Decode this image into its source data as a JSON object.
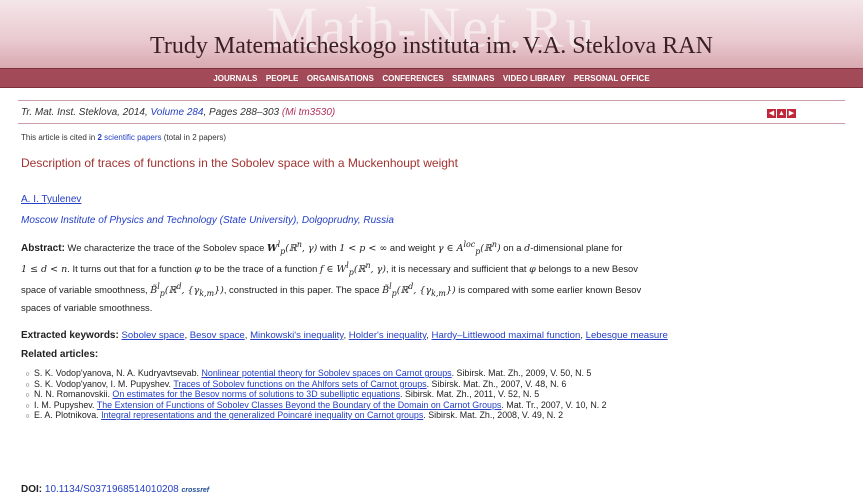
{
  "header": {
    "watermark": "Math-Net.Ru",
    "journal_title": "Trudy Matematicheskogo instituta im. V.A. Steklova RAN"
  },
  "nav": [
    "JOURNALS",
    "PEOPLE",
    "ORGANISATIONS",
    "CONFERENCES",
    "SEMINARS",
    "VIDEO LIBRARY",
    "PERSONAL OFFICE"
  ],
  "reference": {
    "prefix": "Tr. Mat. Inst. Steklova, 2014,",
    "volume_link": "Volume 284",
    "pages": ", Pages 288–303",
    "mi_id": "(Mi tm3530)"
  },
  "nav_arrows": [
    "◀",
    "▲",
    "▶"
  ],
  "cited": {
    "text_before": "This article is cited in",
    "count": "2",
    "link": "scientific papers",
    "text_after": "(total in 2 papers)"
  },
  "article": {
    "title": "Description of traces of functions in the Sobolev space with a Muckenhoupt weight",
    "author": "A. I. Tyulenev",
    "organization": "Moscow Institute of Physics and Technology (State University), Dolgoprudny, Russia"
  },
  "abstract": {
    "label": "Abstract:",
    "t1": " We characterize the trace of the Sobolev space ",
    "m1": "W",
    "m1_sup": "l",
    "m1_sub": "p",
    "m1_tail": "(ℝ",
    "m1_n": "n",
    "m1_end": ", γ)",
    "t2": " with ",
    "m2": "1 < p < ∞",
    "t3": " and weight ",
    "m3": "γ ∈ A",
    "m3_sup": "loc",
    "m3_sub": "p",
    "m3_tail": "(ℝ",
    "m3_n": "n",
    "m3_end": ")",
    "t4": " on a ",
    "m4": "d",
    "t5": "-dimensional plane for",
    "m5": "1 ≤ d < n",
    "t6": ". It turns out that for a function ",
    "m6": "φ",
    "t7": " to be the trace of a function ",
    "m7": "f ∈ W",
    "m7_sup": "l",
    "m7_sub": "p",
    "m7_tail": "(ℝ",
    "m7_n": "n",
    "m7_end": ", γ)",
    "t8": ", it is necessary and sufficient that ",
    "m8": "φ",
    "t9": " belongs to a new Besov",
    "t10": "space of variable smoothness, ",
    "m9": "B̃",
    "m9_sup": "l",
    "m9_sub": "p",
    "m9_tail": "(ℝ",
    "m9_d": "d",
    "m9_end": ", {γ",
    "m9_k": "k,m",
    "m9_close": "})",
    "t11": ", constructed in this paper. The space ",
    "t12": " is compared with some earlier known Besov",
    "t13": "spaces of variable smoothness."
  },
  "keywords": {
    "label": "Extracted keywords:",
    "items": [
      "Sobolev space",
      "Besov space",
      "Minkowski's inequality",
      "Holder's inequality",
      "Hardy–Littlewood maximal function",
      "Lebesgue measure"
    ]
  },
  "related": {
    "label": "Related articles:",
    "items": [
      {
        "authors": "S. K. Vodop'yanova, N. A. Kudryavtsevab.",
        "title": "Nonlinear potential theory for Sobolev spaces on Carnot groups",
        "source": ". Sibirsk. Mat. Zh., 2009, V. 50, N. 5"
      },
      {
        "authors": "S. K. Vodop'yanov, I. M. Pupyshev.",
        "title": "Traces of Sobolev functions on the Ahlfors sets of Carnot groups",
        "source": ". Sibirsk. Mat. Zh., 2007, V. 48, N. 6"
      },
      {
        "authors": "N. N. Romanovskii.",
        "title": "On estimates for the Besov norms of solutions to 3D subelliptic equations",
        "source": ". Sibirsk. Mat. Zh., 2011, V. 52, N. 5"
      },
      {
        "authors": "I. M. Pupyshev.",
        "title": "The Extension of Functions of Sobolev Classes Beyond the Boundary of the Domain on Carnot Groups",
        "source": ". Mat. Tr., 2007, V. 10, N. 2"
      },
      {
        "authors": "E. A. Plotnikova.",
        "title": "Integral representations and the generalized Poincaré inequality on Carnot groups",
        "source": ". Sibirsk. Mat. Zh., 2008, V. 49, N. 2"
      }
    ]
  },
  "doi": {
    "label": "DOI:",
    "value": "10.1134/S0371968514010208",
    "crossref": "crossref"
  },
  "colors": {
    "nav_bg": "#a24a58",
    "link": "#2540c4",
    "title": "#a1332f"
  }
}
